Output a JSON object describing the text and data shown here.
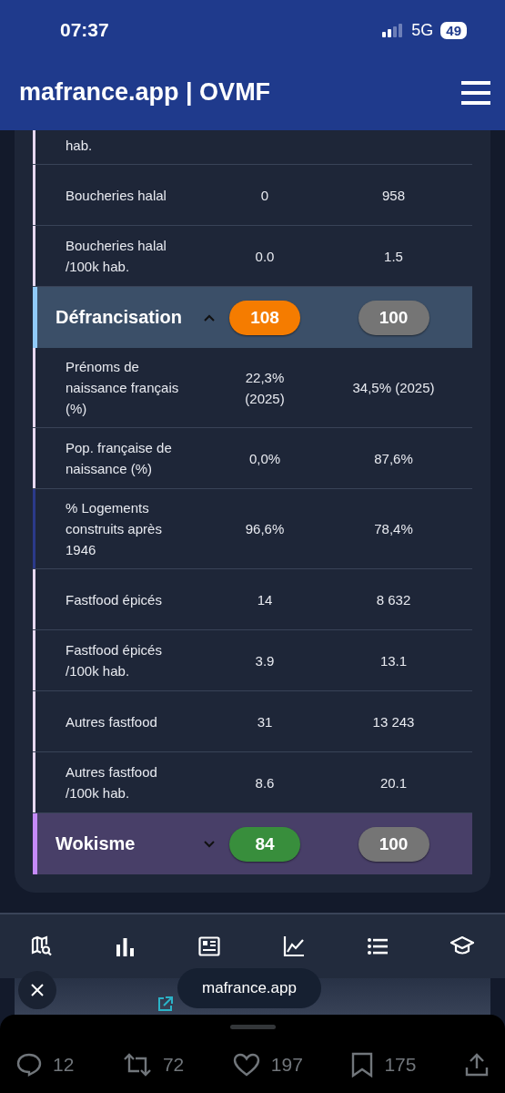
{
  "status_bar": {
    "time": "07:37",
    "network": "5G",
    "battery": "49"
  },
  "header": {
    "title": "mafrance.app | OVMF"
  },
  "sections": [
    {
      "rows": [
        {
          "label": "hab.",
          "color": "#e6d8f0"
        },
        {
          "label": "Boucheries halal",
          "value_1": "0",
          "value_2": "958",
          "color": "#e6d8f0"
        },
        {
          "label": "Boucheries halal /100k hab.",
          "value_1": "0.0",
          "value_2": "1.5",
          "color": "#e6d8f0"
        }
      ]
    },
    {
      "name": "Défrancisation",
      "expanded": true,
      "color": "#90caf9",
      "score": {
        "value": "108",
        "color": "#f57c00"
      },
      "reference": "100",
      "rows": [
        {
          "label": "Prénoms de naissance français (%)",
          "value_1": "22,3% (2025)",
          "value_2": "34,5% (2025)",
          "color": "#e6d8f0"
        },
        {
          "label": "Pop. française de naissance (%)",
          "value_1": "0,0%",
          "value_2": "87,6%",
          "color": "#e6d8f0"
        },
        {
          "label": "% Logements construits après 1946",
          "value_1": "96,6%",
          "value_2": "78,4%",
          "color": "#2b3a8a"
        },
        {
          "label": "Fastfood épicés",
          "value_1": "14",
          "value_2": "8 632",
          "color": "#e6d8f0"
        },
        {
          "label": "Fastfood épicés /100k hab.",
          "value_1": "3.9",
          "value_2": "13.1",
          "color": "#e6d8f0"
        },
        {
          "label": "Autres fastfood",
          "value_1": "31",
          "value_2": "13 243",
          "color": "#e6d8f0"
        },
        {
          "label": "Autres fastfood /100k hab.",
          "value_1": "8.6",
          "value_2": "20.1",
          "color": "#e6d8f0"
        }
      ]
    },
    {
      "name": "Wokisme",
      "expanded": false,
      "color": "#c58af9",
      "score": {
        "value": "84",
        "color": "#388e3c"
      },
      "reference": "100"
    }
  ],
  "browser_chip": {
    "domain": "mafrance.app"
  },
  "post_actions": {
    "replies": "12",
    "reposts": "72",
    "likes": "197",
    "bookmarks": "175"
  }
}
